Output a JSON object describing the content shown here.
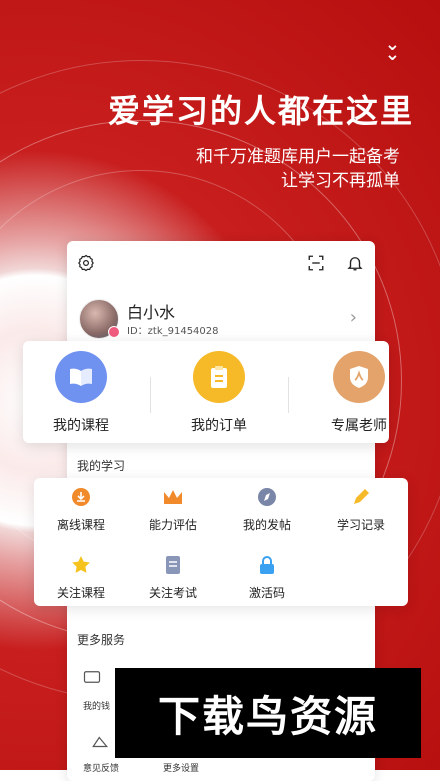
{
  "hero": {
    "headline": "爱学习的人都在这里",
    "line1": "和千万准题库用户一起备考",
    "line2": "让学习不再孤单"
  },
  "profile": {
    "name": "白小水",
    "id": "ID：ztk_91454028"
  },
  "main_actions": [
    {
      "label": "我的课程",
      "icon": "book-icon",
      "color": "#6f92f0"
    },
    {
      "label": "我的订单",
      "icon": "clipboard-icon",
      "color": "#f6b928"
    },
    {
      "label": "专属老师",
      "icon": "teacher-shield-icon",
      "color": "#e4a36b"
    }
  ],
  "study": {
    "title": "我的学习",
    "items": [
      {
        "label": "离线课程",
        "icon": "download-icon"
      },
      {
        "label": "能力评估",
        "icon": "crown-icon"
      },
      {
        "label": "我的发帖",
        "icon": "compass-icon"
      },
      {
        "label": "学习记录",
        "icon": "pencil-icon"
      },
      {
        "label": "关注课程",
        "icon": "star-icon"
      },
      {
        "label": "关注考试",
        "icon": "document-icon"
      },
      {
        "label": "激活码",
        "icon": "lock-icon"
      }
    ]
  },
  "services": {
    "title": "更多服务",
    "items": [
      {
        "label": "我的钱"
      },
      {
        "label": "意见反馈"
      },
      {
        "label": "更多设置"
      }
    ]
  },
  "watermark": "下载鸟资源",
  "colors": {
    "brand_red": "#c81e1e",
    "accent_yellow": "#f6b928"
  }
}
